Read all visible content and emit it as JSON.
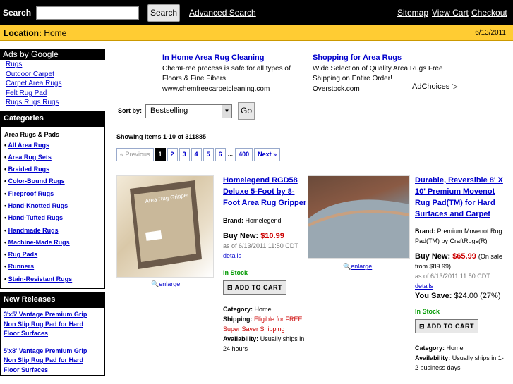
{
  "header": {
    "search_label": "Search",
    "search_button": "Search",
    "advanced": "Advanced Search",
    "sitemap": "Sitemap",
    "view_cart": "View Cart",
    "checkout": "Checkout"
  },
  "location": {
    "label": "Location:",
    "value": "Home",
    "date": "6/13/2011"
  },
  "sidebar": {
    "ads_title": "Ads by Google",
    "ads": [
      "Rugs",
      "Outdoor Carpet",
      "Carpet Area Rugs",
      "Felt Rug Pad",
      "Rugs Rugs Rugs"
    ],
    "categories_title": "Categories",
    "categories_sub": "Area Rugs & Pads",
    "categories": [
      "All Area Rugs",
      "Area Rug Sets",
      "Braided Rugs",
      "Color-Bound Rugs",
      "Fireproof Rugs",
      "Hand-Knotted Rugs",
      "Hand-Tufted Rugs",
      "Handmade Rugs",
      "Machine-Made Rugs",
      "Rug Pads",
      "Runners",
      "Stain-Resistant Rugs"
    ],
    "new_releases_title": "New Releases",
    "new_releases": [
      "3'x5' Vantage Premium Grip",
      "Non Slip Rug Pad for Hard",
      "Floor Surfaces",
      "5'x8' Vantage Premium Grip",
      "Non Slip Rug Pad for Hard",
      "Floor Surfaces"
    ]
  },
  "ads": [
    {
      "title": "In Home Area Rug Cleaning",
      "line1": "ChemFree process is safe for all types of",
      "line2": "Floors & Fine Fibers",
      "url": "www.chemfreecarpetcleaning.com"
    },
    {
      "title": "Shopping for Area Rugs",
      "line1": "Wide Selection of Quality Area Rugs Free",
      "line2": "Shipping on Entire Order!",
      "url": "Overstock.com"
    }
  ],
  "adchoices": "AdChoices",
  "sort": {
    "label": "Sort by:",
    "value": "Bestselling",
    "go": "Go"
  },
  "showing": "Showing items 1-10 of 311885",
  "pager": {
    "prev": "« Previous",
    "pages": [
      "1",
      "2",
      "3",
      "4",
      "5",
      "6"
    ],
    "ellipsis": "...",
    "last": "400",
    "next": "Next »"
  },
  "products": [
    {
      "title": "Homelegend RGD58 Deluxe 5-Foot by 8-Foot Area Rug Gripper",
      "brand_label": "Brand:",
      "brand": "Homelegend",
      "buy_label": "Buy New:",
      "price": "$10.99",
      "asof": "as of 6/13/2011 11:50 CDT",
      "details": "details",
      "stock": "In Stock",
      "cart": "ADD TO CART",
      "cat_label": "Category:",
      "category": "Home",
      "ship_label": "Shipping:",
      "shipping": "Eligible for FREE Super Saver Shipping",
      "avail_label": "Availability:",
      "availability": "Usually ships in 24 hours",
      "enlarge": "enlarge"
    },
    {
      "title": "Durable, Reversible 8' X 10' Premium Movenot Rug Pad(TM) for Hard Surfaces and Carpet",
      "brand_label": "Brand:",
      "brand": "Premium Movenot Rug Pad(TM) by CraftRugs(R)",
      "buy_label": "Buy New:",
      "price": "$65.99",
      "sale": "(On sale from $89.99)",
      "asof": "as of 6/13/2011 11:50 CDT",
      "details": "details",
      "save_label": "You Save:",
      "save": "$24.00 (27%)",
      "stock": "In Stock",
      "cart": "ADD TO CART",
      "cat_label": "Category:",
      "category": "Home",
      "avail_label": "Availability:",
      "availability": "Usually ships in 1-2 business days",
      "enlarge": "enlarge"
    }
  ]
}
